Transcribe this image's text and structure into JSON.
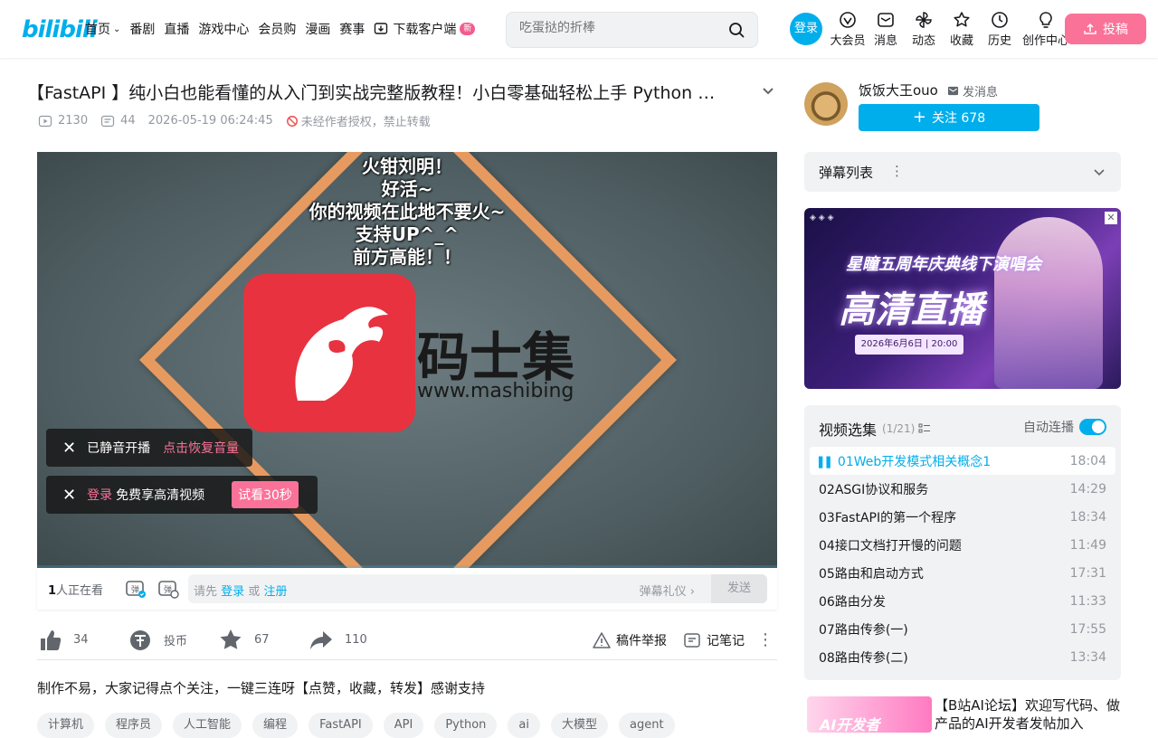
{
  "header": {
    "logo": "bilibili",
    "nav": [
      "首页",
      "番剧",
      "直播",
      "游戏中心",
      "会员购",
      "漫画",
      "赛事",
      "下载客户端"
    ],
    "nav_badge": "新",
    "search_placeholder": "吃蛋挞的折棒",
    "login": "登录",
    "right_nav": [
      "大会员",
      "消息",
      "动态",
      "收藏",
      "历史",
      "创作中心"
    ],
    "upload": "投稿"
  },
  "video": {
    "title": "【FastAPI 】纯小白也能看懂的从入门到实战完整版教程！小白零基础轻松上手 Python …",
    "views": "2130",
    "danmaku_count": "44",
    "date": "2026-05-19 06:24:45",
    "copyright": "未经作者授权，禁止转载",
    "danmaku_lines": [
      "火钳刘明！",
      "好活~",
      "你的视频在此地不要火~",
      "支持UP^_^",
      "前方高能！！"
    ],
    "brand_text": "码士集",
    "brand_url": "www.mashibing",
    "toast_mute": "已静音开播",
    "toast_mute_action": "点击恢复音量",
    "toast_login": "登录",
    "toast_login_text": "免费享高清视频",
    "toast_trial": "试看30秒"
  },
  "danmaku_bar": {
    "watching_num": "1",
    "watching_text": "人正在看",
    "prompt": "请先",
    "login": "登录",
    "or": "或",
    "register": "注册",
    "etiquette": "弹幕礼仪",
    "send": "发送"
  },
  "actions": {
    "like": "34",
    "coin": "投币",
    "fav": "67",
    "share": "110",
    "report": "稿件举报",
    "notes": "记笔记"
  },
  "description": "制作不易，大家记得点个关注，一键三连呀【点赞，收藏，转发】感谢支持",
  "tags": [
    "计算机",
    "程序员",
    "人工智能",
    "编程",
    "FastAPI",
    "API",
    "Python",
    "ai",
    "大模型",
    "agent"
  ],
  "uploader": {
    "name": "饭饭大王ouo",
    "message": "发消息",
    "follow": "关注 678"
  },
  "sidebar": {
    "danmaku_list": "弹幕列表",
    "ad_title_small": "星瞳五周年庆典线下演唱会",
    "ad_title_big": "高清直播",
    "ad_date": "2026年6月6日 | 20:00"
  },
  "playlist": {
    "title": "视频选集",
    "count": "(1/21)",
    "autoplay": "自动连播",
    "items": [
      {
        "name": "01Web开发模式相关概念1",
        "dur": "18:04"
      },
      {
        "name": "02ASGI协议和服务",
        "dur": "14:29"
      },
      {
        "name": "03FastAPI的第一个程序",
        "dur": "18:34"
      },
      {
        "name": "04接口文档打开慢的问题",
        "dur": "11:49"
      },
      {
        "name": "05路由和启动方式",
        "dur": "17:31"
      },
      {
        "name": "06路由分发",
        "dur": "11:33"
      },
      {
        "name": "07路由传参(一)",
        "dur": "17:55"
      },
      {
        "name": "08路由传参(二)",
        "dur": "13:34"
      }
    ]
  },
  "promo": {
    "img_text": "AI开发者",
    "text": "【B站AI论坛】欢迎写代码、做产品的AI开发者发帖加入"
  }
}
